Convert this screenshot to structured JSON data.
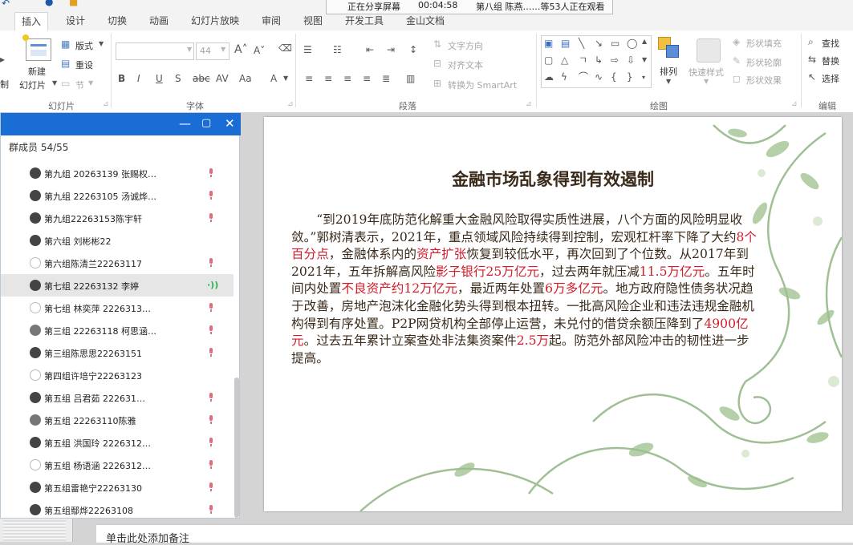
{
  "share_bar": {
    "status": "正在分享屏幕",
    "timer": "00:04:58",
    "viewers": "第八组 陈燕……等53人正在观看"
  },
  "ribbon": {
    "tabs": [
      {
        "label": "插入",
        "active": true
      },
      {
        "label": "设计"
      },
      {
        "label": "切换"
      },
      {
        "label": "动画"
      },
      {
        "label": "幻灯片放映"
      },
      {
        "label": "审阅"
      },
      {
        "label": "视图"
      },
      {
        "label": "开发工具"
      },
      {
        "label": "金山文档"
      }
    ],
    "slides_group": {
      "new_slide": "新建",
      "new_slide_2": "幻灯片",
      "layout": "版式",
      "reset": "重设",
      "section": "节",
      "left_cut": "制",
      "label": "幻灯片"
    },
    "font_group": {
      "size": "44",
      "label": "字体"
    },
    "paragraph_group": {
      "text_direction": "文字方向",
      "align_text": "对齐文本",
      "convert_smartart": "转换为 SmartArt",
      "label": "段落"
    },
    "drawing_group": {
      "arrange": "排列",
      "quick_styles": "快速样式",
      "shape_fill": "形状填充",
      "shape_outline": "形状轮廓",
      "shape_effects": "形状效果",
      "label": "绘图"
    },
    "editing_group": {
      "find": "查找",
      "replace": "替换",
      "select": "选择",
      "label": "编辑"
    }
  },
  "members_panel": {
    "count_label": "群成员 54/55",
    "members": [
      {
        "name": "第九组 20263139 张赐权…",
        "mic": "muted"
      },
      {
        "name": "第九组 22263105 汤诚烨…",
        "mic": "muted"
      },
      {
        "name": "第九组22263153陈宇轩",
        "mic": "muted"
      },
      {
        "name": "第六组 刘彬彬22",
        "mic": "none"
      },
      {
        "name": "第六组陈清兰22263117",
        "mic": "muted"
      },
      {
        "name": "第七组 22263132 李婷",
        "mic": "speaking",
        "selected": true
      },
      {
        "name": "第七组 林奕萍 2226313…",
        "mic": "muted"
      },
      {
        "name": "第三组 22263118 柯思涵…",
        "mic": "muted"
      },
      {
        "name": "第三组陈思思22263151",
        "mic": "muted"
      },
      {
        "name": "第四组许培宁22263123",
        "mic": "none"
      },
      {
        "name": "第五组 吕君茹 222631…",
        "mic": "muted"
      },
      {
        "name": "第五组 22263110陈雅",
        "mic": "muted"
      },
      {
        "name": "第五组 洪国玲 2226312…",
        "mic": "muted"
      },
      {
        "name": "第五组 杨语涵 2226312…",
        "mic": "muted"
      },
      {
        "name": "第五组雷艳宁22263130",
        "mic": "muted"
      },
      {
        "name": "第五组鄢烨22263108",
        "mic": "muted"
      }
    ]
  },
  "slide": {
    "title": "金融市场乱象得到有效遏制",
    "body": [
      {
        "t": "“到2019年底防范化解重大金融风险取得实质性进展，八个方面的风险明显收敛。”郭树清表示，2021年，重点领域风险持续得到控制，宏观杠杆率下降了大约"
      },
      {
        "t": "8个百分点",
        "red": true
      },
      {
        "t": "，金融体系内的"
      },
      {
        "t": "资产扩张",
        "red": true
      },
      {
        "t": "恢复到较低水平，再次回到了个位数。从2017年到2021年，五年拆解高风险"
      },
      {
        "t": "影子银行25万亿元",
        "red": true
      },
      {
        "t": "，过去两年就压减"
      },
      {
        "t": "11.5万亿元",
        "red": true
      },
      {
        "t": "。五年时间内处置"
      },
      {
        "t": "不良资产约12万亿元",
        "red": true
      },
      {
        "t": "，最近两年处置"
      },
      {
        "t": "6万多亿元",
        "red": true
      },
      {
        "t": "。地方政府隐性债务状况趋于改善，房地产泡沫化金融化势头得到根本扭转。一批高风险企业和违法违规金融机构得到有序处置。P2P网贷机构全部停止运营，未兑付的借贷余额压降到了"
      },
      {
        "t": "4900亿元",
        "red": true
      },
      {
        "t": "。过去五年累计立案查处非法集资案件"
      },
      {
        "t": "2.5万",
        "red": true
      },
      {
        "t": "起。防范外部风险冲击的韧性进一步提高。"
      }
    ]
  },
  "notes": {
    "placeholder": "单击此处添加备注"
  }
}
